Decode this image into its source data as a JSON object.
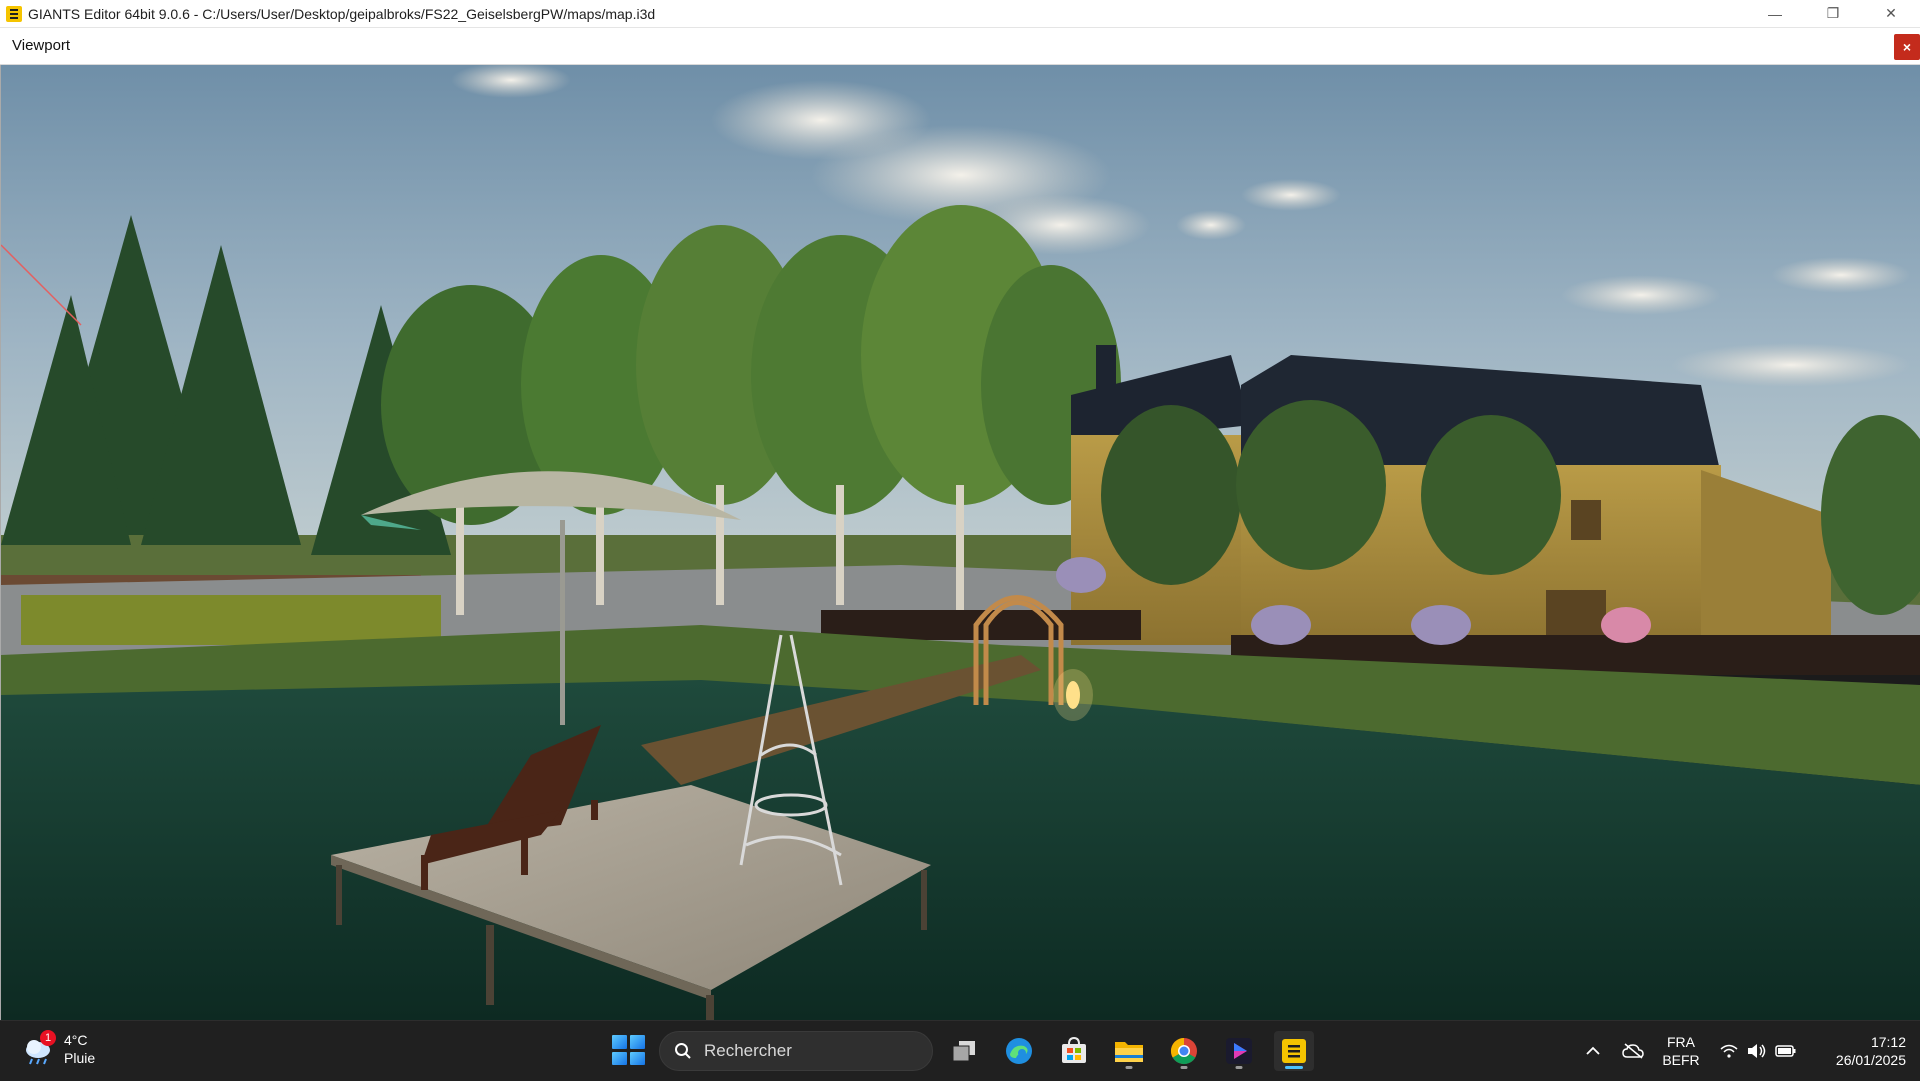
{
  "window": {
    "title": "GIANTS Editor 64bit 9.0.6 - C:/Users/User/Desktop/geipalbroks/FS22_GeiselsbergPW/maps/map.i3d",
    "minimize_glyph": "—",
    "restore_glyph": "❐",
    "close_glyph": "✕"
  },
  "panel": {
    "title": "Viewport",
    "close_glyph": "×"
  },
  "taskbar": {
    "weather": {
      "temperature": "4°C",
      "condition": "Pluie",
      "badge": "1",
      "icon": "rain-cloud-icon"
    },
    "search": {
      "placeholder": "Rechercher",
      "icon": "search-icon"
    },
    "apps": [
      {
        "name": "task-view",
        "icon": "task-view-icon"
      },
      {
        "name": "edge",
        "icon": "edge-icon"
      },
      {
        "name": "store",
        "icon": "store-icon"
      },
      {
        "name": "file-explorer",
        "icon": "folder-icon"
      },
      {
        "name": "chrome",
        "icon": "chrome-icon"
      },
      {
        "name": "media-player",
        "icon": "play-icon"
      },
      {
        "name": "giants-editor",
        "icon": "giants-editor-icon",
        "active": true
      }
    ],
    "tray": {
      "chevron": "^",
      "language_primary": "FRA",
      "language_secondary": "BEFR",
      "time": "17:12",
      "date": "26/01/2025"
    }
  },
  "colors": {
    "accent": "#4cc2ff",
    "taskbar_bg": "#202020",
    "close_red": "#c42b1c",
    "app_yellow": "#f5c400"
  }
}
